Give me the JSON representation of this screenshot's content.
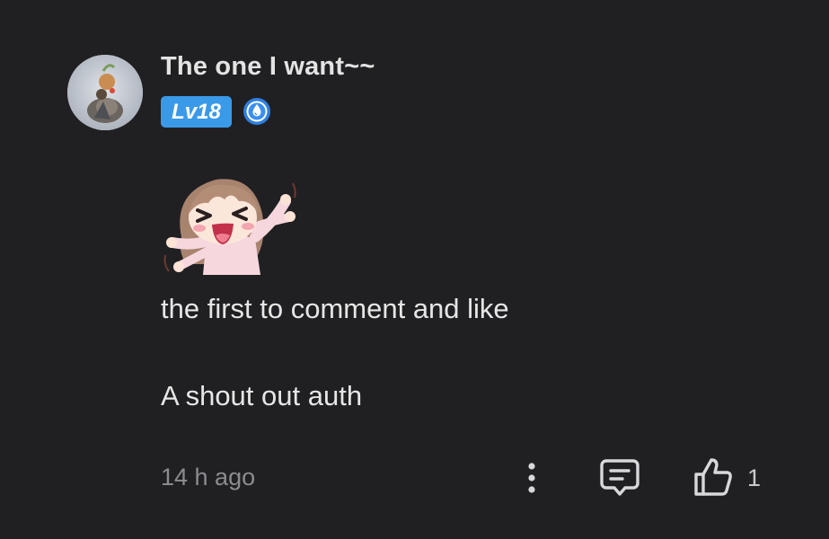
{
  "comment": {
    "author": "The one I want~~",
    "level_label": "Lv18",
    "text_lines": [
      "the first to comment and like",
      "A shout out auth"
    ],
    "timestamp": "14 h ago",
    "like_count": "1"
  },
  "colors": {
    "background": "#202023",
    "level_badge": "#3b9ae8",
    "medal": "#2f7fe0",
    "icon": "#d8d8dc",
    "muted_text": "#8c8c90"
  },
  "icons": {
    "avatar": "avatar-image",
    "medal": "water-drop-medal-icon",
    "sticker": "excited-anime-girl-sticker",
    "more": "vertical-dots-icon",
    "reply": "comment-bubble-icon",
    "like": "thumbs-up-icon"
  }
}
